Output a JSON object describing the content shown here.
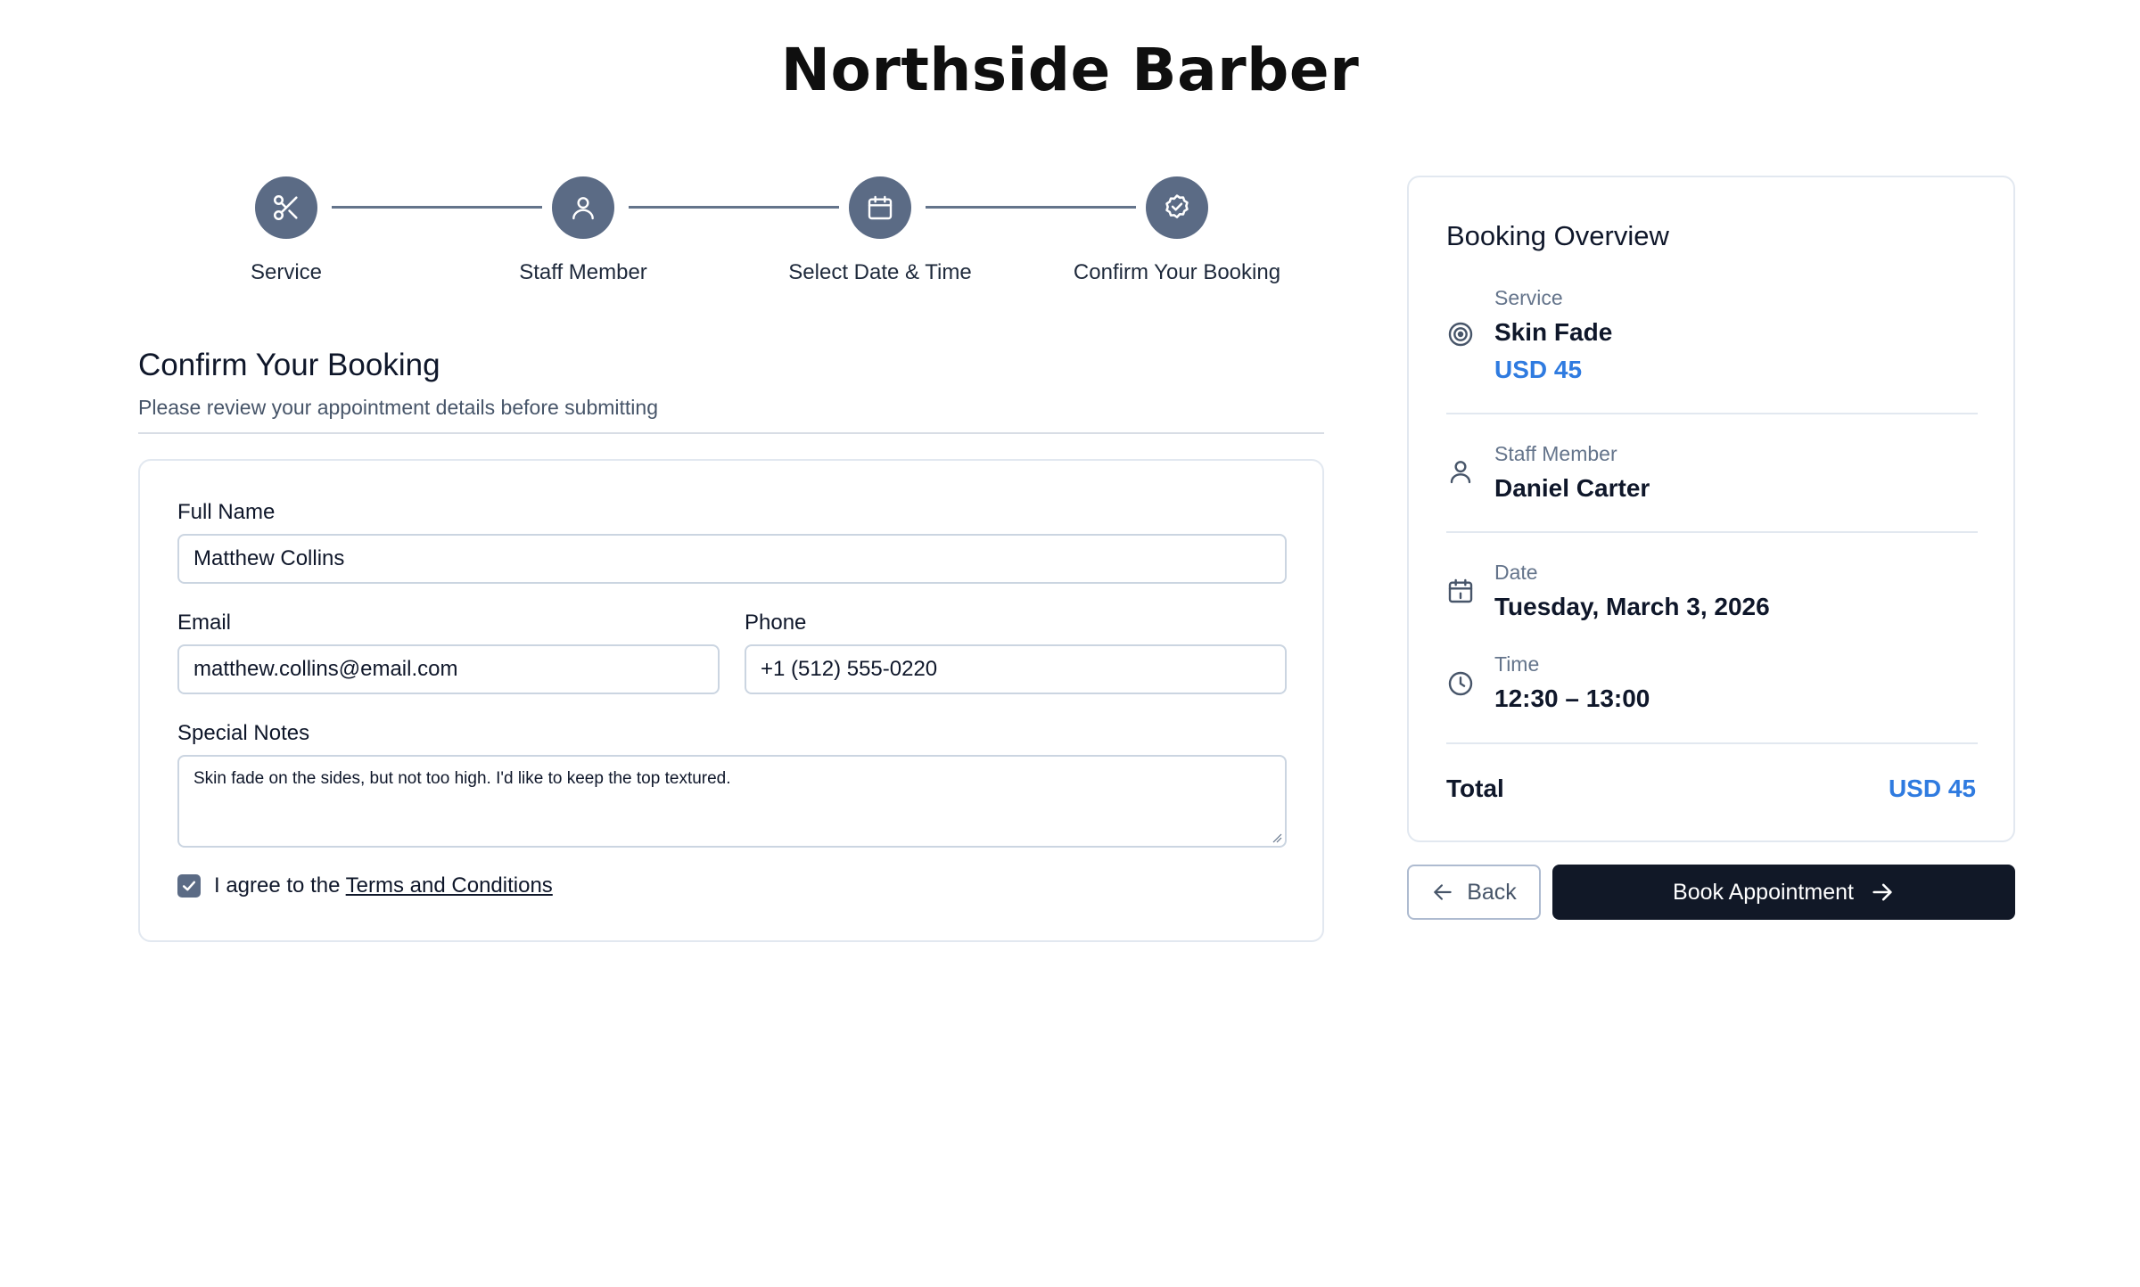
{
  "site": {
    "title": "Northside Barber"
  },
  "stepper": {
    "steps": [
      {
        "label": "Service",
        "icon": "scissors-icon"
      },
      {
        "label": "Staff Member",
        "icon": "user-icon"
      },
      {
        "label": "Select Date & Time",
        "icon": "calendar-icon"
      },
      {
        "label": "Confirm Your Booking",
        "icon": "badge-check-icon"
      }
    ]
  },
  "form": {
    "title": "Confirm Your Booking",
    "subtitle": "Please review your appointment details before submitting",
    "full_name_label": "Full Name",
    "full_name_value": "Matthew Collins",
    "email_label": "Email",
    "email_value": "matthew.collins@email.com",
    "phone_label": "Phone",
    "phone_value": "+1 (512) 555-0220",
    "notes_label": "Special Notes",
    "notes_value": "Skin fade on the sides, but not too high. I'd like to keep the top textured.",
    "agree_prefix": "I agree to the ",
    "agree_link": "Terms and Conditions",
    "agree_checked": true
  },
  "overview": {
    "title": "Booking Overview",
    "service_label": "Service",
    "service_value": "Skin Fade",
    "service_price": "USD 45",
    "staff_label": "Staff Member",
    "staff_value": "Daniel Carter",
    "date_label": "Date",
    "date_value": "Tuesday, March 3, 2026",
    "time_label": "Time",
    "time_value": "12:30 – 13:00",
    "total_label": "Total",
    "total_value": "USD 45"
  },
  "actions": {
    "back_label": "Back",
    "book_label": "Book Appointment"
  },
  "colors": {
    "step_circle": "#5b6b85",
    "price_accent": "#2f7be0",
    "primary_button": "#111827"
  }
}
